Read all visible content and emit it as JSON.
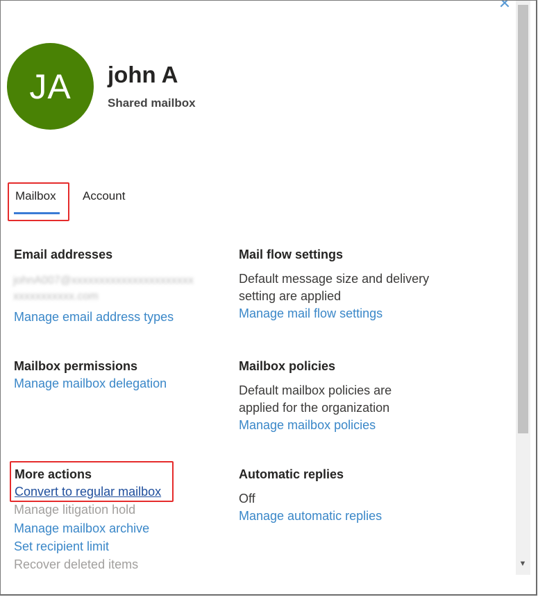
{
  "panel": {
    "close_glyph": "✕"
  },
  "header": {
    "initials": "JA",
    "name": "john A",
    "mailbox_type": "Shared mailbox",
    "avatar_color": "#498205"
  },
  "tabs": [
    {
      "label": "Mailbox",
      "selected": true
    },
    {
      "label": "Account",
      "selected": false
    }
  ],
  "sections": {
    "email_addresses": {
      "title": "Email addresses",
      "blurred_line1": "johnA007@xxxxxxxxxxxxxxxxxxxxxx",
      "blurred_line2": "xxxxxxxxxxx.com",
      "link": "Manage email address types"
    },
    "mail_flow": {
      "title": "Mail flow settings",
      "line1": "Default message size and delivery",
      "line2": "setting are applied",
      "link": "Manage mail flow settings"
    },
    "mailbox_permissions": {
      "title": "Mailbox permissions",
      "link": "Manage mailbox delegation"
    },
    "mailbox_policies": {
      "title": "Mailbox policies",
      "line1": "Default mailbox policies are",
      "line2": "applied for the organization",
      "link": "Manage mailbox policies"
    },
    "more_actions": {
      "title": "More actions",
      "convert_link": "Convert to regular mailbox",
      "litigation": "Manage litigation hold",
      "archive": "Manage mailbox archive",
      "recipient_limit": "Set recipient limit",
      "recover": "Recover deleted items"
    },
    "automatic_replies": {
      "title": "Automatic replies",
      "status": "Off",
      "link": "Manage automatic replies"
    }
  },
  "colors": {
    "link": "#3a87c8",
    "highlight_box": "#e52b2b",
    "tab_underline": "#3a7bd5"
  }
}
